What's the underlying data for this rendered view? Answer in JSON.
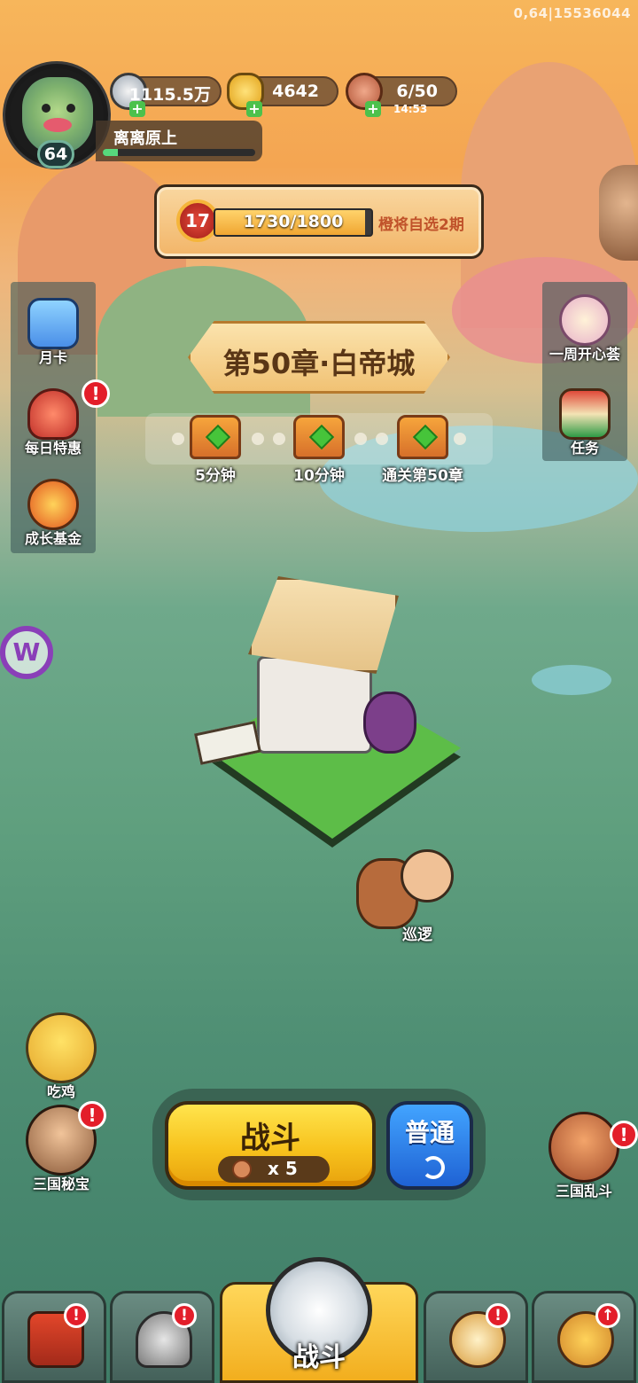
{
  "debug_text": "0,64|15536044",
  "player": {
    "level": "64",
    "name": "离离原上",
    "exp_fraction": 0.1
  },
  "resources": {
    "silver": "1115.5万",
    "gold": "4642",
    "stamina": "6/50",
    "stamina_timer": "14:53"
  },
  "vip": {
    "level": "17",
    "progress": "1730/1800",
    "progress_fraction": 0.96,
    "promo": "橙将自选2期"
  },
  "left_menu": [
    {
      "label": "月卡",
      "icon": "month-card-icon"
    },
    {
      "label": "每日特惠",
      "icon": "gift-bag-icon",
      "alert": "!"
    },
    {
      "label": "成长基金",
      "icon": "growth-fund-icon"
    }
  ],
  "right_menu": [
    {
      "label": "一周开心荟",
      "icon": "weekly-event-icon"
    },
    {
      "label": "任务",
      "icon": "scroll-icon"
    }
  ],
  "chapter": {
    "title": "第50章·白帝城",
    "chests": [
      {
        "label": "5分钟"
      },
      {
        "label": "10分钟"
      },
      {
        "label": "通关第50章"
      }
    ]
  },
  "patrol": {
    "label": "巡逻"
  },
  "left_events": [
    {
      "label": "吃鸡",
      "icon": "chicken-dinner-icon"
    },
    {
      "label": "三国秘宝",
      "icon": "treasure-icon",
      "alert": "!"
    }
  ],
  "right_event": {
    "label": "三国乱斗",
    "icon": "brawl-icon",
    "alert": "!"
  },
  "battle": {
    "label": "战斗",
    "cost": "x 5",
    "mode": "普通"
  },
  "nav": {
    "center_label": "战斗",
    "tabs": [
      {
        "icon": "city-gate-icon",
        "alert": "!"
      },
      {
        "icon": "helmet-icon",
        "alert": "!"
      },
      {
        "icon": "horn-stars-icon",
        "alert": "!"
      },
      {
        "icon": "fist-upgrade-icon",
        "alert": "↑"
      }
    ]
  },
  "colors": {
    "accent_yellow": "#f7c21d",
    "mode_blue": "#1f62d4",
    "alert_red": "#e31e2a"
  }
}
